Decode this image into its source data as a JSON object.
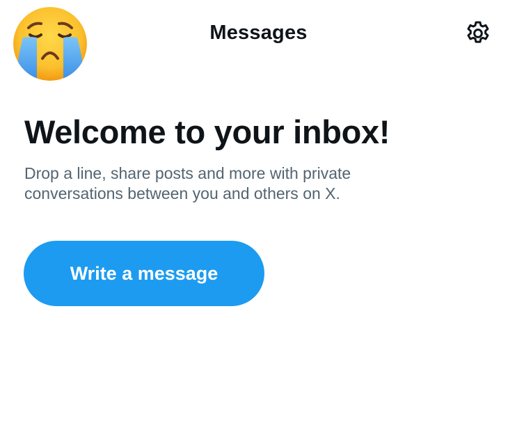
{
  "header": {
    "title": "Messages",
    "avatar_icon": "crying-face-emoji",
    "settings_icon": "gear-icon"
  },
  "empty_state": {
    "headline": "Welcome to your inbox!",
    "description": "Drop a line, share posts and more with private conversations between you and others on X.",
    "cta_label": "Write a message"
  },
  "colors": {
    "accent": "#1d9bf0",
    "text_primary": "#0f1419",
    "text_secondary": "#536471",
    "background": "#ffffff"
  }
}
